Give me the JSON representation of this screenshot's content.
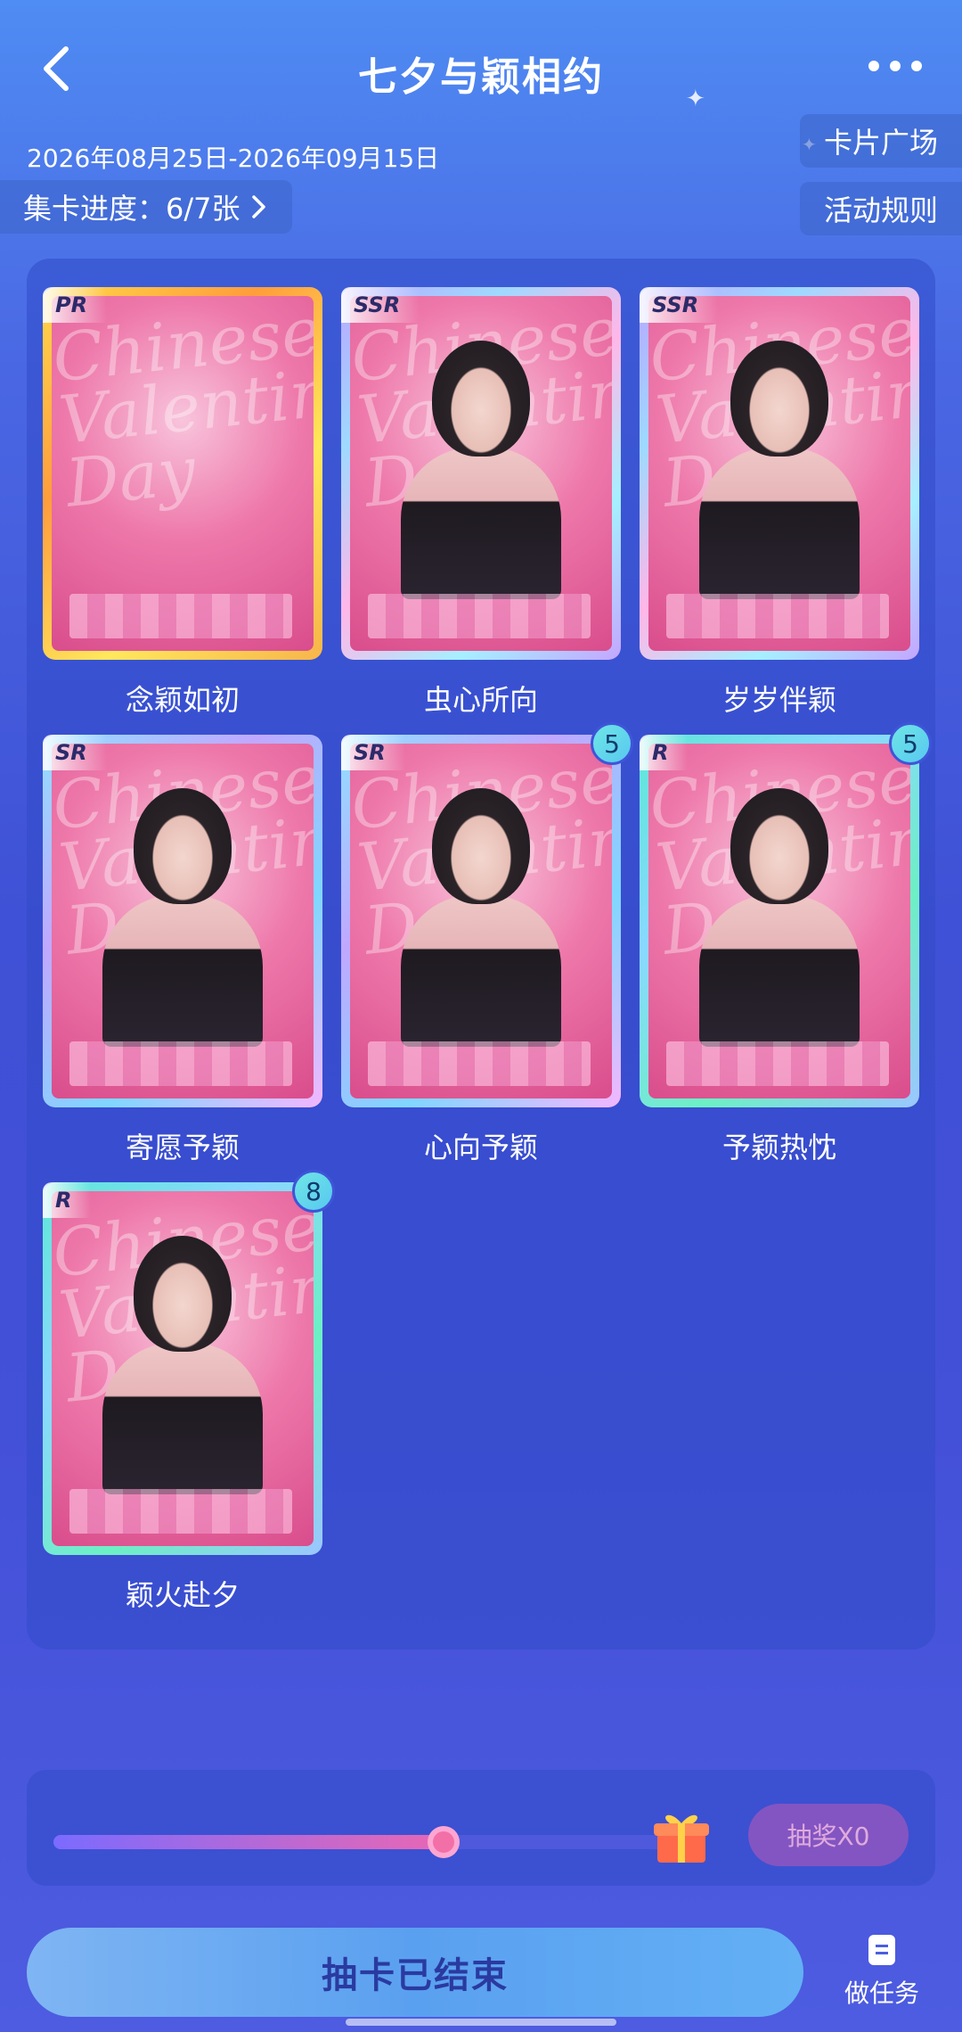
{
  "header": {
    "title": "七夕与颖相约",
    "back_icon": "chevron-left-icon",
    "more_icon": "more-dots-icon"
  },
  "event": {
    "date_range": "2026年08月25日-2026年09月15日",
    "progress_label": "集卡进度：6/7张",
    "card_square_label": "卡片广场",
    "rules_label": "活动规则"
  },
  "cards": [
    {
      "name": "念颖如初",
      "rarity": "PR",
      "count": null
    },
    {
      "name": "虫心所向",
      "rarity": "SSR",
      "count": null
    },
    {
      "name": "岁岁伴颖",
      "rarity": "SSR",
      "count": null
    },
    {
      "name": "寄愿予颖",
      "rarity": "SR",
      "count": null
    },
    {
      "name": "心向予颖",
      "rarity": "SR",
      "count": "5"
    },
    {
      "name": "予颖热忱",
      "rarity": "R",
      "count": "5"
    },
    {
      "name": "颖火赴夕",
      "rarity": "R",
      "count": "8"
    }
  ],
  "card_art_text": "Chinese Valentine's Day",
  "reward": {
    "progress_fraction": 0.6,
    "lottery_label": "抽奖X0"
  },
  "bottom": {
    "draw_label": "抽卡已结束",
    "task_label": "做任务"
  },
  "colors": {
    "accent_pink": "#e867b4",
    "badge_teal": "#6ee6e6",
    "background_blue": "#3f51d6"
  }
}
